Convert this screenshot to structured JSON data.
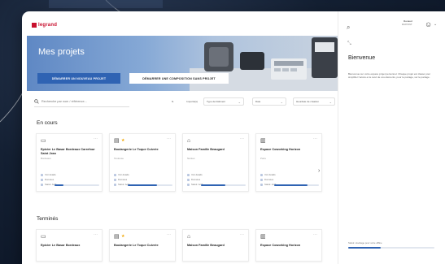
{
  "brand": {
    "logo_text": "legrand",
    "accent": "#c8102e",
    "primary": "#2f63b3"
  },
  "hero": {
    "title": "Mes projets",
    "primary_button": "DÉMARRER UN NOUVEAU PROJET",
    "secondary_button": "DÉMARRER UNE COMPOSITION SANS PROJET"
  },
  "search": {
    "placeholder": "Recherche par nom / référence..."
  },
  "filters": [
    {
      "label": "Importé(s)",
      "icon": "sort-icon"
    },
    {
      "label": "Type de bâtiment"
    },
    {
      "label": "Date"
    },
    {
      "label": "Heurdate de création"
    }
  ],
  "sections": {
    "in_progress": "En cours",
    "finished": "Terminés"
  },
  "projects_in_progress": [
    {
      "icon": "shop-icon",
      "name": "Epicier Le Basar Bordeaux Carrefour Saint Jean",
      "sub": "Bordeaux",
      "starred": false,
      "meta": [
        "Voir détails",
        "Données",
        "Statut: Actif"
      ],
      "progress": 0.2
    },
    {
      "icon": "calendar-icon",
      "name": "Boulangerie Le Toque Cuivrée",
      "sub": "Toulouse",
      "starred": true,
      "meta": [
        "Voir détails",
        "Données",
        "Statut: Actif"
      ],
      "progress": 0.65
    },
    {
      "icon": "house-icon",
      "name": "Maison Famille Beaugard",
      "sub": "Nantes",
      "starred": false,
      "meta": [
        "Voir détails",
        "Données",
        "Statut: Actif"
      ],
      "progress": 0.55
    },
    {
      "icon": "building-icon",
      "name": "Espace Coworking Horizon",
      "sub": "Paris",
      "starred": false,
      "meta": [
        "Voir détails",
        "Données",
        "Statut: Actif"
      ],
      "progress": 0.75
    }
  ],
  "projects_finished": [
    {
      "icon": "shop-icon",
      "name": "Epicier Le Basar Bordeaux",
      "starred": false
    },
    {
      "icon": "calendar-icon",
      "name": "Boulangerie Le Toque Cuivrée",
      "starred": true
    },
    {
      "icon": "house-icon",
      "name": "Maison Famille Beaugard",
      "starred": false
    },
    {
      "icon": "building-icon",
      "name": "Espace Coworking Horizon",
      "starred": false
    }
  ],
  "sidebar": {
    "user_name": "Renaud",
    "user_role": "DUPONT",
    "welcome_title": "Bienvenue",
    "welcome_text": "Bienvenue sur votre espace projet personnel. Chaque projet est classé pour simplifier l’accès et le suivi de vos éléments, pour le partage, sur le partage.",
    "storage_label": "Statut: stockage pour votre offline",
    "storage_progress": 0.38
  }
}
